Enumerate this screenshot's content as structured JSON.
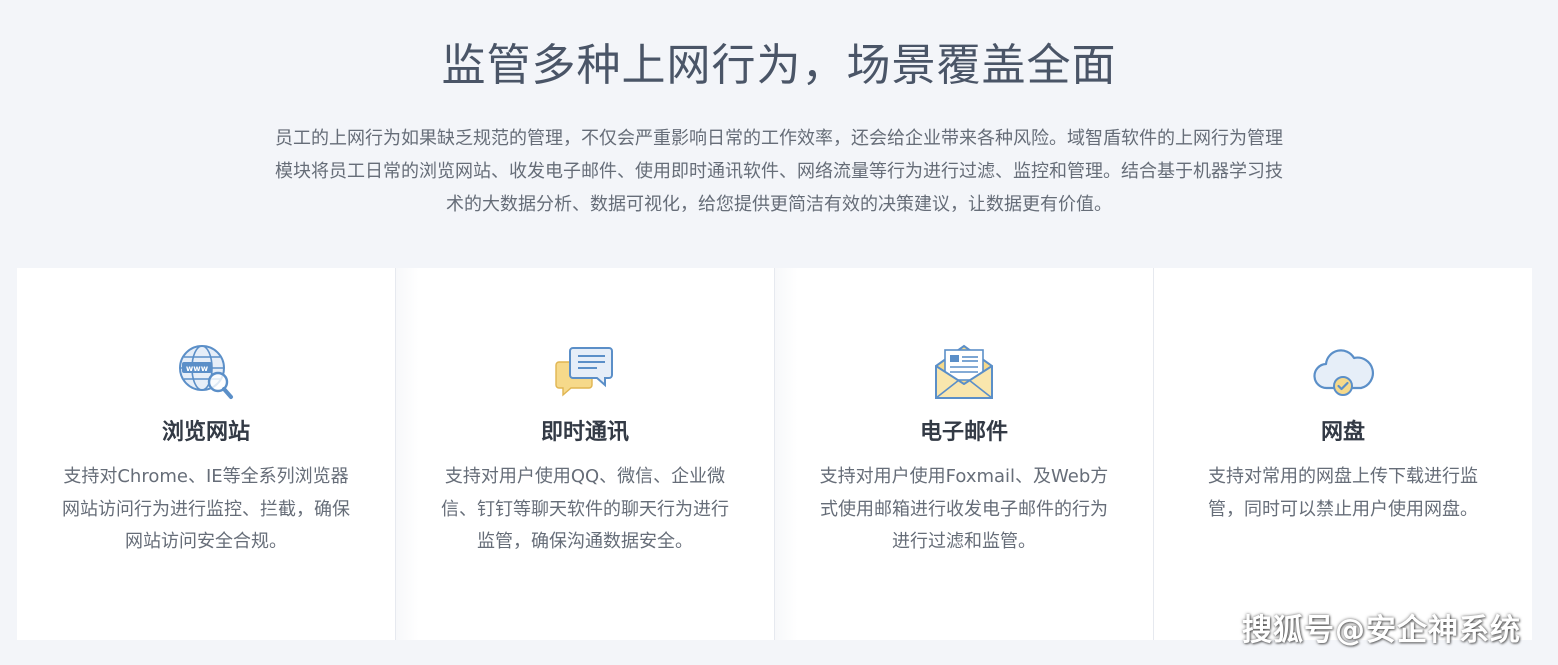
{
  "section": {
    "title": "监管多种上网行为，场景覆盖全面",
    "description": "员工的上网行为如果缺乏规范的管理，不仅会严重影响日常的工作效率，还会给企业带来各种风险。域智盾软件的上网行为管理模块将员工日常的浏览网站、收发电子邮件、使用即时通讯软件、网络流量等行为进行过滤、监控和管理。结合基于机器学习技术的大数据分析、数据可视化，给您提供更简洁有效的决策建议，让数据更有价值。"
  },
  "cards": [
    {
      "icon": "globe-search-icon",
      "title": "浏览网站",
      "description": "支持对Chrome、IE等全系列浏览器网站访问行为进行监控、拦截，确保网站访问安全合规。"
    },
    {
      "icon": "chat-bubbles-icon",
      "title": "即时通讯",
      "description": "支持对用户使用QQ、微信、企业微信、钉钉等聊天软件的聊天行为进行监管，确保沟通数据安全。"
    },
    {
      "icon": "envelope-icon",
      "title": "电子邮件",
      "description": "支持对用户使用Foxmail、及Web方式使用邮箱进行收发电子邮件的行为进行过滤和监管。"
    },
    {
      "icon": "cloud-check-icon",
      "title": "网盘",
      "description": "支持对常用的网盘上传下载进行监管，同时可以禁止用户使用网盘。"
    }
  ],
  "watermark": "搜狐号@安企神系统",
  "colors": {
    "background": "#f3f5f9",
    "card": "#ffffff",
    "title": "#4a5567",
    "text": "#666d78",
    "icon_blue": "#5b8fc8",
    "icon_yellow": "#f6d98a"
  }
}
